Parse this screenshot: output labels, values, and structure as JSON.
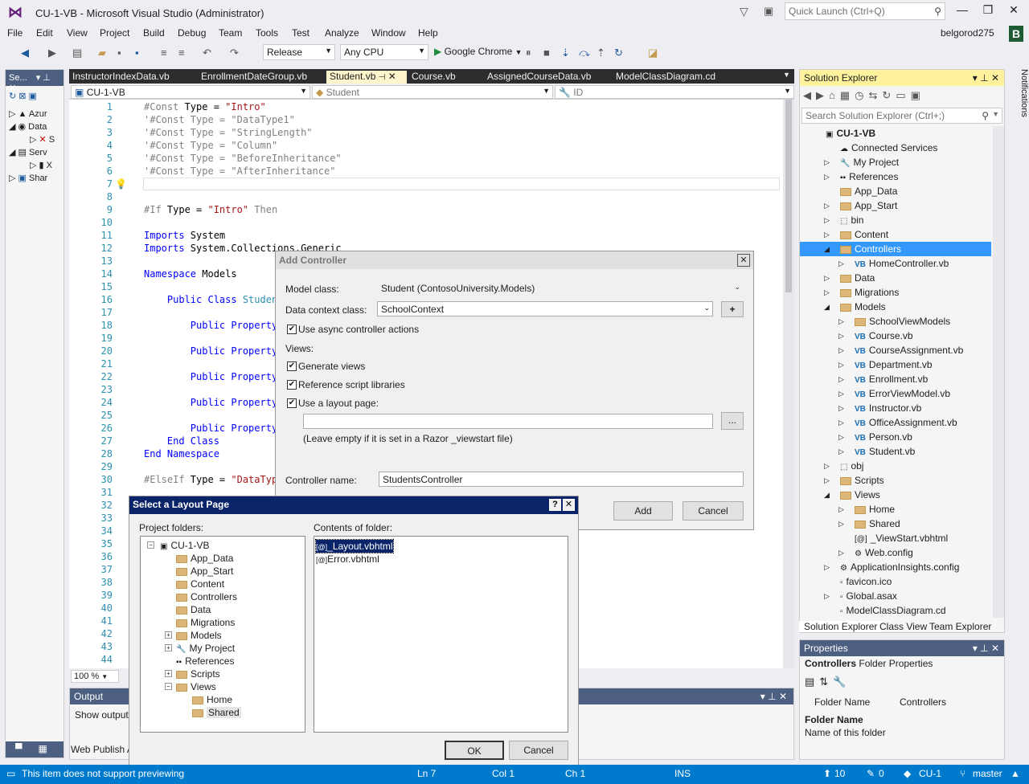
{
  "window": {
    "title": "CU-1-VB - Microsoft Visual Studio  (Administrator)",
    "quick_launch_placeholder": "Quick Launch (Ctrl+Q)",
    "user": "belgorod275",
    "user_initial": "B"
  },
  "menu": [
    "File",
    "Edit",
    "View",
    "Project",
    "Build",
    "Debug",
    "Team",
    "Tools",
    "Test",
    "Analyze",
    "Window",
    "Help"
  ],
  "toolbar": {
    "config": "Release",
    "platform": "Any CPU",
    "run_target": "Google Chrome"
  },
  "left_panel": {
    "title": "Se...",
    "rows": [
      "Azur",
      "Data",
      "S",
      "Serv",
      "X",
      "Shar"
    ]
  },
  "doc_tabs": [
    "InstructorIndexData.vb",
    "EnrollmentDateGroup.vb",
    "Student.vb",
    "Course.vb",
    "AssignedCourseData.vb",
    "ModelClassDiagram.cd"
  ],
  "nav": {
    "project": "CU-1-VB",
    "class": "Student",
    "member": "ID"
  },
  "code_lines": [
    {
      "n": "1",
      "segs": [
        [
          "gray",
          "#Const "
        ],
        [
          "",
          "Type = "
        ],
        [
          "str",
          "\"Intro\""
        ]
      ]
    },
    {
      "n": "2",
      "segs": [
        [
          "gray",
          "'#Const Type = \"DataType1\""
        ]
      ]
    },
    {
      "n": "3",
      "segs": [
        [
          "gray",
          "'#Const Type = \"StringLength\""
        ]
      ]
    },
    {
      "n": "4",
      "segs": [
        [
          "gray",
          "'#Const Type = \"Column\""
        ]
      ]
    },
    {
      "n": "5",
      "segs": [
        [
          "gray",
          "'#Const Type = \"BeforeInheritance\""
        ]
      ]
    },
    {
      "n": "6",
      "segs": [
        [
          "gray",
          "'#Const Type = \"AfterInheritance\""
        ]
      ]
    },
    {
      "n": "7",
      "segs": []
    },
    {
      "n": "8",
      "segs": []
    },
    {
      "n": "9",
      "segs": [
        [
          "gray",
          "#If "
        ],
        [
          "",
          "Type = "
        ],
        [
          "str",
          "\"Intro\""
        ],
        [
          "gray",
          " Then"
        ]
      ]
    },
    {
      "n": "10",
      "segs": []
    },
    {
      "n": "11",
      "segs": [
        [
          "kw",
          "Imports "
        ],
        [
          "",
          "System"
        ]
      ]
    },
    {
      "n": "12",
      "segs": [
        [
          "kw",
          "Imports "
        ],
        [
          "",
          "System.Collections.Generic"
        ]
      ]
    },
    {
      "n": "13",
      "segs": []
    },
    {
      "n": "14",
      "segs": [
        [
          "kw",
          "Namespace "
        ],
        [
          "",
          "Models"
        ]
      ]
    },
    {
      "n": "15",
      "segs": []
    },
    {
      "n": "16",
      "segs": [
        [
          "kw",
          "    Public Class "
        ],
        [
          "tp",
          "Studen"
        ]
      ]
    },
    {
      "n": "17",
      "segs": []
    },
    {
      "n": "18",
      "segs": [
        [
          "kw",
          "        Public Property"
        ]
      ]
    },
    {
      "n": "19",
      "segs": []
    },
    {
      "n": "20",
      "segs": [
        [
          "kw",
          "        Public Property"
        ]
      ]
    },
    {
      "n": "21",
      "segs": []
    },
    {
      "n": "22",
      "segs": [
        [
          "kw",
          "        Public Property"
        ]
      ]
    },
    {
      "n": "23",
      "segs": []
    },
    {
      "n": "24",
      "segs": [
        [
          "kw",
          "        Public Property"
        ]
      ]
    },
    {
      "n": "25",
      "segs": []
    },
    {
      "n": "26",
      "segs": [
        [
          "kw",
          "        Public Property"
        ]
      ]
    },
    {
      "n": "27",
      "segs": [
        [
          "kw",
          "    End Class"
        ]
      ]
    },
    {
      "n": "28",
      "segs": [
        [
          "kw",
          "End Namespace"
        ]
      ]
    },
    {
      "n": "29",
      "segs": []
    },
    {
      "n": "30",
      "segs": [
        [
          "gray",
          "#ElseIf "
        ],
        [
          "",
          "Type = "
        ],
        [
          "str",
          "\"DataTyp"
        ]
      ]
    },
    {
      "n": "31",
      "segs": []
    },
    {
      "n": "32",
      "segs": []
    },
    {
      "n": "33",
      "segs": []
    },
    {
      "n": "34",
      "segs": []
    },
    {
      "n": "35",
      "segs": []
    },
    {
      "n": "36",
      "segs": []
    },
    {
      "n": "37",
      "segs": []
    },
    {
      "n": "38",
      "segs": []
    },
    {
      "n": "39",
      "segs": []
    },
    {
      "n": "40",
      "segs": []
    },
    {
      "n": "41",
      "segs": []
    },
    {
      "n": "42",
      "segs": []
    },
    {
      "n": "43",
      "segs": []
    },
    {
      "n": "44",
      "segs": []
    }
  ],
  "zoom": "100 %",
  "output": {
    "title": "Output",
    "text": "Show output f"
  },
  "web_publish": "Web Publish A",
  "solution": {
    "title": "Solution Explorer",
    "search_placeholder": "Search Solution Explorer (Ctrl+;)",
    "items": [
      {
        "label": "CU-1-VB",
        "indent": 0,
        "kind": "sln",
        "exp": ""
      },
      {
        "label": "Connected Services",
        "indent": 1,
        "kind": "svc",
        "exp": ""
      },
      {
        "label": "My Project",
        "indent": 1,
        "kind": "wrench",
        "exp": "▷"
      },
      {
        "label": "References",
        "indent": 1,
        "kind": "ref",
        "exp": "▷"
      },
      {
        "label": "App_Data",
        "indent": 1,
        "kind": "folder",
        "exp": ""
      },
      {
        "label": "App_Start",
        "indent": 1,
        "kind": "folder",
        "exp": "▷"
      },
      {
        "label": "bin",
        "indent": 1,
        "kind": "dashed",
        "exp": "▷"
      },
      {
        "label": "Content",
        "indent": 1,
        "kind": "folder",
        "exp": "▷"
      },
      {
        "label": "Controllers",
        "indent": 1,
        "kind": "folder",
        "exp": "◢",
        "sel": true
      },
      {
        "label": "HomeController.vb",
        "indent": 2,
        "kind": "vb",
        "exp": "▷"
      },
      {
        "label": "Data",
        "indent": 1,
        "kind": "folder",
        "exp": "▷"
      },
      {
        "label": "Migrations",
        "indent": 1,
        "kind": "folder",
        "exp": "▷"
      },
      {
        "label": "Models",
        "indent": 1,
        "kind": "folder",
        "exp": "◢"
      },
      {
        "label": "SchoolViewModels",
        "indent": 2,
        "kind": "folder",
        "exp": "▷"
      },
      {
        "label": "Course.vb",
        "indent": 2,
        "kind": "vb",
        "exp": "▷"
      },
      {
        "label": "CourseAssignment.vb",
        "indent": 2,
        "kind": "vb",
        "exp": "▷"
      },
      {
        "label": "Department.vb",
        "indent": 2,
        "kind": "vb",
        "exp": "▷"
      },
      {
        "label": "Enrollment.vb",
        "indent": 2,
        "kind": "vb",
        "exp": "▷"
      },
      {
        "label": "ErrorViewModel.vb",
        "indent": 2,
        "kind": "vb",
        "exp": "▷"
      },
      {
        "label": "Instructor.vb",
        "indent": 2,
        "kind": "vb",
        "exp": "▷"
      },
      {
        "label": "OfficeAssignment.vb",
        "indent": 2,
        "kind": "vb",
        "exp": "▷"
      },
      {
        "label": "Person.vb",
        "indent": 2,
        "kind": "vb",
        "exp": "▷"
      },
      {
        "label": "Student.vb",
        "indent": 2,
        "kind": "vb",
        "exp": "▷"
      },
      {
        "label": "obj",
        "indent": 1,
        "kind": "dashed",
        "exp": "▷"
      },
      {
        "label": "Scripts",
        "indent": 1,
        "kind": "folder",
        "exp": "▷"
      },
      {
        "label": "Views",
        "indent": 1,
        "kind": "folder",
        "exp": "◢"
      },
      {
        "label": "Home",
        "indent": 2,
        "kind": "folder",
        "exp": "▷"
      },
      {
        "label": "Shared",
        "indent": 2,
        "kind": "folder",
        "exp": "▷"
      },
      {
        "label": "_ViewStart.vbhtml",
        "indent": 2,
        "kind": "razor",
        "exp": ""
      },
      {
        "label": "Web.config",
        "indent": 2,
        "kind": "config",
        "exp": "▷"
      },
      {
        "label": "ApplicationInsights.config",
        "indent": 1,
        "kind": "config",
        "exp": "▷"
      },
      {
        "label": "favicon.ico",
        "indent": 1,
        "kind": "file",
        "exp": ""
      },
      {
        "label": "Global.asax",
        "indent": 1,
        "kind": "file",
        "exp": "▷"
      },
      {
        "label": "ModelClassDiagram.cd",
        "indent": 1,
        "kind": "file",
        "exp": ""
      }
    ],
    "tabs": [
      "Solution Explorer",
      "Class View",
      "Team Explorer"
    ]
  },
  "notifications": "Notifications",
  "properties": {
    "title": "Properties",
    "object": "Controllers",
    "object_type": "Folder Properties",
    "prop_name": "Folder Name",
    "prop_value": "Controllers",
    "desc_title": "Folder Name",
    "desc_text": "Name of this folder"
  },
  "add_controller": {
    "title": "Add Controller",
    "model_label": "Model class:",
    "model_value": "Student (ContosoUniversity.Models)",
    "context_label": "Data context class:",
    "context_value": "SchoolContext",
    "async_label": "Use async controller actions",
    "views_label": "Views:",
    "gen_views": "Generate views",
    "ref_scripts": "Reference script libraries",
    "use_layout": "Use a layout page:",
    "layout_value": "",
    "browse": "...",
    "hint": "(Leave empty if it is set in a Razor _viewstart file)",
    "name_label": "Controller name:",
    "name_value": "StudentsController",
    "add": "Add",
    "cancel": "Cancel",
    "plus": "+"
  },
  "layout_dialog": {
    "title": "Select a Layout Page",
    "help": "?",
    "project_folders": "Project folders:",
    "contents": "Contents of folder:",
    "tree": [
      {
        "label": "CU-1-VB",
        "level": 0,
        "pm": "−",
        "kind": "proj"
      },
      {
        "label": "App_Data",
        "level": 1,
        "pm": "",
        "kind": "folder"
      },
      {
        "label": "App_Start",
        "level": 1,
        "pm": "",
        "kind": "folder"
      },
      {
        "label": "Content",
        "level": 1,
        "pm": "",
        "kind": "folder"
      },
      {
        "label": "Controllers",
        "level": 1,
        "pm": "",
        "kind": "folder"
      },
      {
        "label": "Data",
        "level": 1,
        "pm": "",
        "kind": "folder"
      },
      {
        "label": "Migrations",
        "level": 1,
        "pm": "",
        "kind": "folder"
      },
      {
        "label": "Models",
        "level": 1,
        "pm": "+",
        "kind": "folder"
      },
      {
        "label": "My Project",
        "level": 1,
        "pm": "+",
        "kind": "wrench"
      },
      {
        "label": "References",
        "level": 1,
        "pm": "",
        "kind": "ref"
      },
      {
        "label": "Scripts",
        "level": 1,
        "pm": "+",
        "kind": "folder"
      },
      {
        "label": "Views",
        "level": 1,
        "pm": "−",
        "kind": "folder"
      },
      {
        "label": "Home",
        "level": 2,
        "pm": "",
        "kind": "folder"
      },
      {
        "label": "Shared",
        "level": 2,
        "pm": "",
        "kind": "folder",
        "sel": true
      }
    ],
    "files": [
      {
        "label": "_Layout.vbhtml",
        "sel": true
      },
      {
        "label": "Error.vbhtml"
      }
    ],
    "ok": "OK",
    "cancel": "Cancel"
  },
  "status": {
    "message": "This item does not support previewing",
    "ln": "Ln 7",
    "col": "Col 1",
    "ch": "Ch 1",
    "ins": "INS",
    "up": "10",
    "pencil": "0",
    "repo": "CU-1",
    "branch": "master"
  }
}
